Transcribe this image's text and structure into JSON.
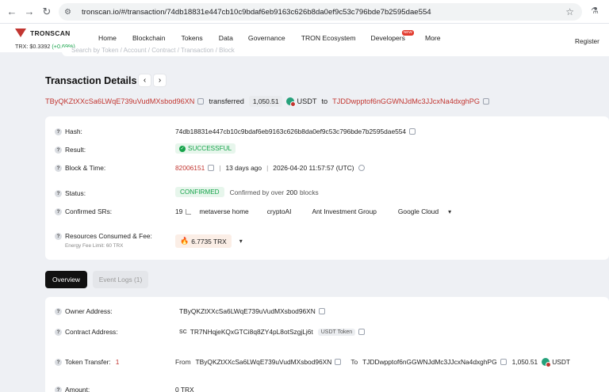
{
  "browser": {
    "url": "tronscan.io/#/transaction/74db18831e447cb10c9bdaf6eb9163c626b8da0ef9c53c796bde7b2595dae554"
  },
  "header": {
    "logo_text": "TRONSCAN",
    "trx_price_label": "TRX: $0.3392",
    "trx_price_change": "(+0.69%)",
    "menu": [
      {
        "label": "Home"
      },
      {
        "label": "Blockchain"
      },
      {
        "label": "Tokens"
      },
      {
        "label": "Data"
      },
      {
        "label": "Governance"
      },
      {
        "label": "TRON Ecosystem"
      },
      {
        "label": "Developers",
        "badge": "NEW"
      },
      {
        "label": "More"
      }
    ],
    "register": "Register"
  },
  "search": {
    "placeholder": "Search by Token / Account / Contract / Transaction / Block"
  },
  "page": {
    "title": "Transaction Details"
  },
  "summary": {
    "from": "TByQKZtXXcSa6LWqE739uVudMXsbod96XN",
    "transferred_word": "transferred",
    "amount": "1,050.51",
    "token": "USDT",
    "to_word": "to",
    "to": "TJDDwpptof6nGGWNJdMc3JJcxNa4dxghPG"
  },
  "details": {
    "hash_label": "Hash:",
    "hash_value": "74db18831e447cb10c9bdaf6eb9163c626b8da0ef9c53c796bde7b2595dae554",
    "result_label": "Result:",
    "result_value": "SUCCESSFUL",
    "block_label": "Block & Time:",
    "block_number": "82006151",
    "block_age": "13 days ago",
    "block_time": "2026-04-20 11:57:57 (UTC)",
    "status_label": "Status:",
    "status_value": "CONFIRMED",
    "confirmed_text": "Confirmed by over",
    "confirmed_count": "200",
    "confirmed_unit": "blocks",
    "srs_label": "Confirmed SRs:",
    "srs_count": "19",
    "srs": [
      "metaverse home",
      "cryptoAI",
      "Ant Investment Group",
      "Google Cloud"
    ],
    "resources_label": "Resources Consumed & Fee:",
    "resources_value": "6.7735 TRX",
    "energy_fee_limit": "Energy Fee Limit: 60 TRX"
  },
  "tabs": [
    {
      "label": "Overview"
    },
    {
      "label": "Event Logs (1)"
    }
  ],
  "overview": {
    "owner_label": "Owner Address:",
    "owner_value": "TByQKZtXXcSa6LWqE739uVudMXsbod96XN",
    "contract_label": "Contract Address:",
    "contract_badge": "SC",
    "contract_value": "TR7NHqjeKQxGTCi8q8ZY4pL8otSzgjLj6t",
    "contract_tag": "USDT Token",
    "token_transfer_label": "Token Transfer:",
    "token_transfer_count": "1",
    "tt_from_label": "From",
    "tt_from": "TByQKZtXXcSa6LWqE739uVudMXsbod96XN",
    "tt_to_label": "To",
    "tt_to": "TJDDwpptof6nGGWNJdMc3JJcxNa4dxghPG",
    "tt_amount": "1,050.51",
    "tt_token": "USDT",
    "amount_label": "Amount:",
    "amount_value": "0 TRX"
  }
}
